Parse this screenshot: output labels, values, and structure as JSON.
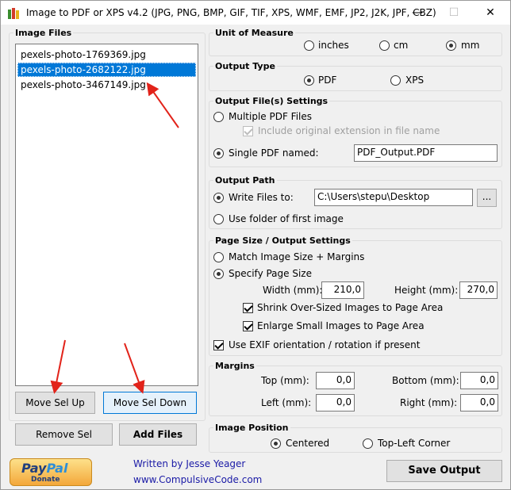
{
  "window": {
    "title": "Image to PDF or XPS  v4.2   (JPG, PNG, BMP, GIF, TIF, XPS, WMF, EMF, JP2, J2K, JPF, CBZ)",
    "minimize": "—",
    "maximize": "☐",
    "close": "✕"
  },
  "image_files": {
    "label": "Image Files",
    "items": [
      "pexels-photo-1769369.jpg",
      "pexels-photo-2682122.jpg",
      "pexels-photo-3467149.jpg"
    ],
    "selected_index": 1
  },
  "buttons": {
    "move_up": "Move Sel Up",
    "move_down": "Move Sel Down",
    "remove": "Remove Sel",
    "add": "Add Files",
    "save": "Save Output",
    "browse": "..."
  },
  "unit": {
    "label": "Unit of Measure",
    "options": [
      "inches",
      "cm",
      "mm"
    ],
    "selected": "mm"
  },
  "output_type": {
    "label": "Output Type",
    "options": [
      "PDF",
      "XPS"
    ],
    "selected": "PDF"
  },
  "output_files": {
    "label": "Output File(s) Settings",
    "multiple": "Multiple PDF Files",
    "include_ext": "Include original extension in file name",
    "single": "Single PDF named:",
    "single_value": "PDF_Output.PDF"
  },
  "output_path": {
    "label": "Output Path",
    "write_to": "Write Files to:",
    "path_value": "C:\\Users\\stepu\\Desktop",
    "use_first": "Use folder of first image"
  },
  "page_size": {
    "label": "Page Size / Output Settings",
    "match": "Match Image Size + Margins",
    "specify": "Specify Page Size",
    "width_label": "Width (mm):",
    "width_value": "210,0",
    "height_label": "Height (mm):",
    "height_value": "270,0",
    "shrink": "Shrink Over-Sized Images to Page Area",
    "enlarge": "Enlarge Small Images to Page Area",
    "exif": "Use EXIF orientation / rotation if present"
  },
  "margins": {
    "label": "Margins",
    "top_label": "Top (mm):",
    "top_value": "0,0",
    "bottom_label": "Bottom (mm):",
    "bottom_value": "0,0",
    "left_label": "Left (mm):",
    "left_value": "0,0",
    "right_label": "Right (mm):",
    "right_value": "0,0"
  },
  "image_position": {
    "label": "Image Position",
    "options": [
      "Centered",
      "Top-Left Corner"
    ],
    "selected": "Centered"
  },
  "footer": {
    "paypal_brand_1": "Pay",
    "paypal_brand_2": "Pal",
    "paypal_donate": "Donate",
    "author": "Written by Jesse Yeager",
    "website": "www.CompulsiveCode.com"
  },
  "colors": {
    "selection": "#0078d7",
    "link": "#1a1aa6",
    "annotation_arrow": "#e2231a"
  }
}
